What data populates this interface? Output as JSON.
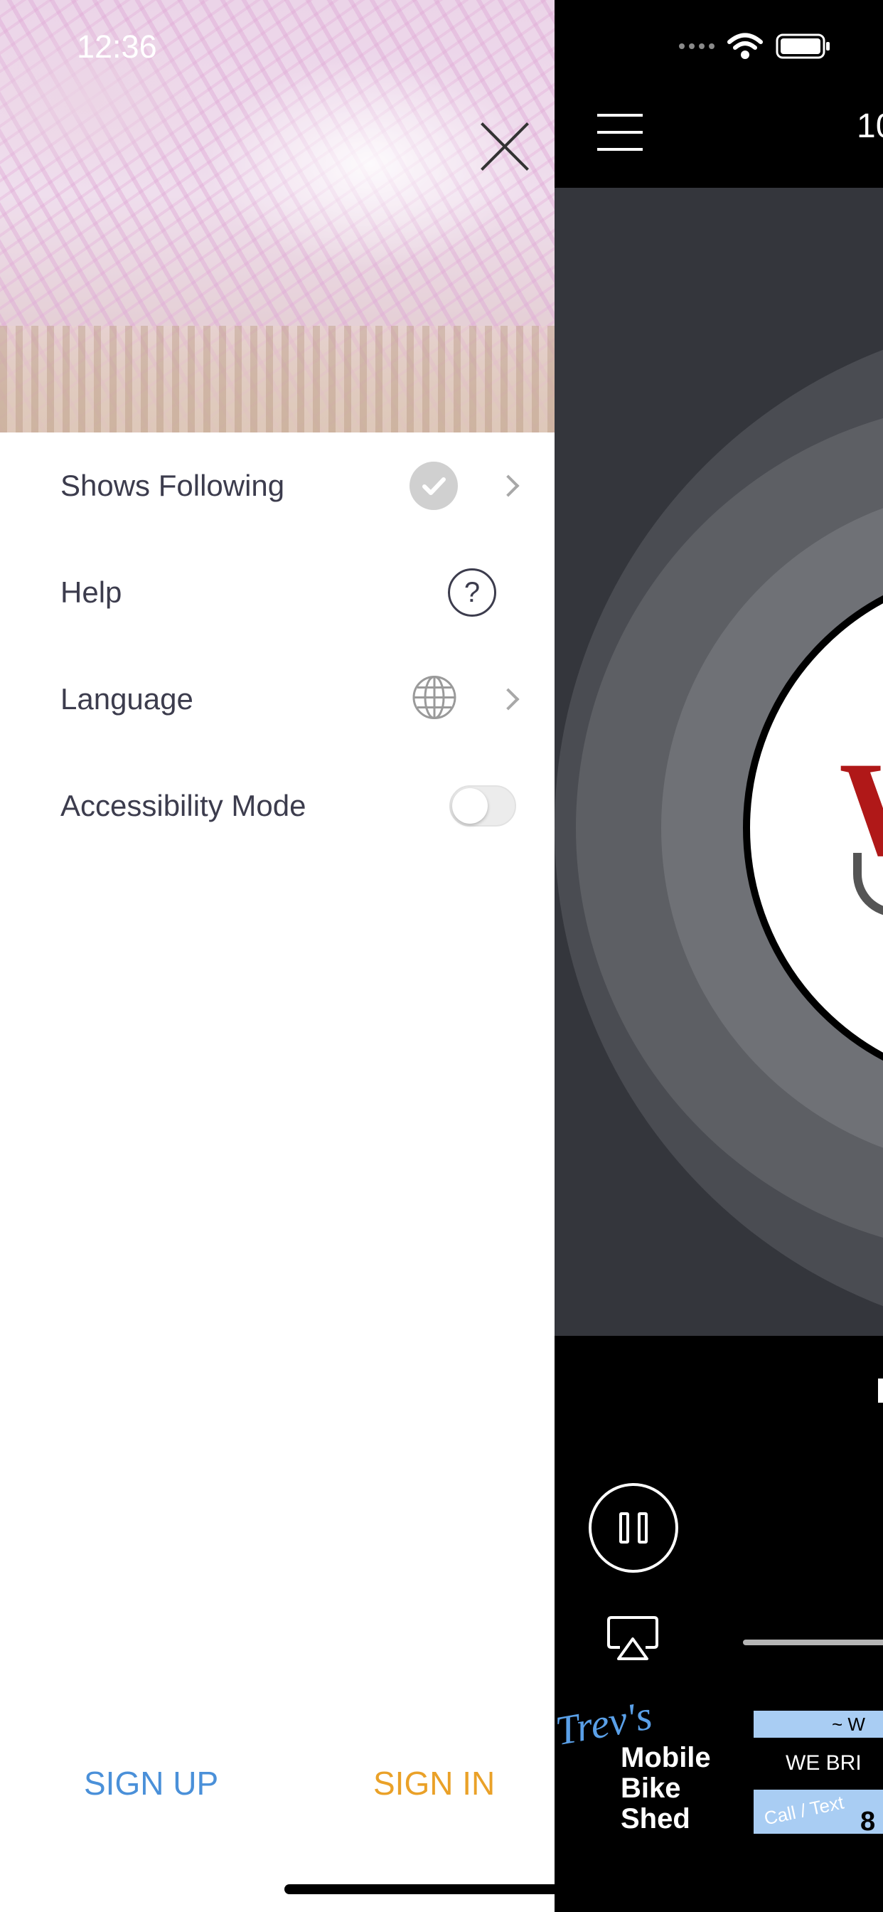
{
  "status_bar": {
    "time": "12:36"
  },
  "drawer": {
    "close_icon": "close-x-icon",
    "menu_items": [
      {
        "label": "Shows Following",
        "icon": "check-circle-icon",
        "has_chevron": true
      },
      {
        "label": "Help",
        "icon": "question-circle-icon",
        "icon_text": "?",
        "has_chevron": false
      },
      {
        "label": "Language",
        "icon": "globe-icon",
        "has_chevron": true
      },
      {
        "label": "Accessibility Mode",
        "control": "toggle",
        "toggle_on": false
      }
    ],
    "sign_up_label": "SIGN UP",
    "sign_in_label": "SIGN IN",
    "colors": {
      "sign_up": "#4a90d9",
      "sign_in": "#eaa128",
      "label": "#3c3c4d"
    }
  },
  "player": {
    "title_partial": "10",
    "logo_letter_partial": "W",
    "ad": {
      "brand_script": "Trev's",
      "brand_line1": "Mobile",
      "brand_line2": "Bike",
      "brand_line3": "Shed",
      "banner_partial": "~ W",
      "tagline_partial": "WE BRI",
      "call_text": "Call / Text",
      "number_partial": "8"
    }
  }
}
